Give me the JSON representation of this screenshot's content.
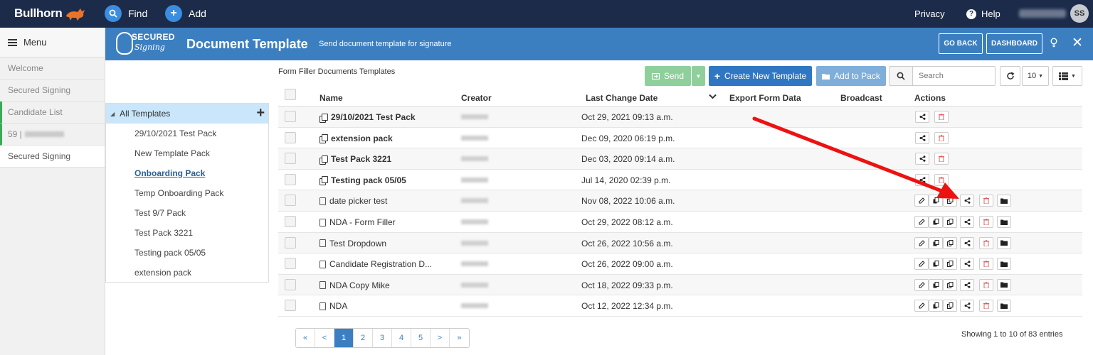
{
  "topbar": {
    "brand": "Bullhorn",
    "find_label": "Find",
    "add_label": "Add",
    "privacy_label": "Privacy",
    "help_label": "Help",
    "avatar_initials": "SS"
  },
  "menu": {
    "title": "Menu",
    "items": [
      {
        "label": "Welcome"
      },
      {
        "label": "Secured Signing"
      },
      {
        "label": "Candidate List"
      },
      {
        "label": "59 |"
      },
      {
        "label": "Secured Signing"
      }
    ]
  },
  "header": {
    "logo_top": "SECURED",
    "logo_bottom": "Signing",
    "title": "Document Template",
    "subtitle": "Send document template for signature",
    "go_back_label": "GO BACK",
    "dashboard_label": "DASHBOARD"
  },
  "tree": {
    "root_label": "All Templates",
    "items": [
      {
        "label": "29/10/2021 Test Pack"
      },
      {
        "label": "New Template Pack"
      },
      {
        "label": "Onboarding Pack"
      },
      {
        "label": "Temp Onboarding Pack"
      },
      {
        "label": "Test 9/7 Pack"
      },
      {
        "label": "Test Pack 3221"
      },
      {
        "label": "Testing pack 05/05"
      },
      {
        "label": "extension pack"
      }
    ]
  },
  "main": {
    "section_title": "Form Filler Documents Templates",
    "send_label": "Send",
    "create_label": "Create New Template",
    "add_pack_label": "Add to Pack",
    "search_placeholder": "Search",
    "page_size": "10",
    "columns": {
      "name": "Name",
      "creator": "Creator",
      "last_change": "Last Change Date",
      "export": "Export Form Data",
      "broadcast": "Broadcast",
      "actions": "Actions"
    },
    "rows": [
      {
        "name": "29/10/2021 Test Pack",
        "date": "Oct 29, 2021 09:13 a.m."
      },
      {
        "name": "extension pack",
        "date": "Dec 09, 2020 06:19 p.m."
      },
      {
        "name": "Test Pack 3221",
        "date": "Dec 03, 2020 09:14 a.m."
      },
      {
        "name": "Testing pack 05/05",
        "date": "Jul 14, 2020 02:39 p.m."
      },
      {
        "name": "date picker test",
        "date": "Nov 08, 2022 10:06 a.m."
      },
      {
        "name": "NDA - Form Filler",
        "date": "Oct 29, 2022 08:12 a.m."
      },
      {
        "name": "Test Dropdown",
        "date": "Oct 26, 2022 10:56 a.m."
      },
      {
        "name": "Candidate Registration D...",
        "date": "Oct 26, 2022 09:00 a.m."
      },
      {
        "name": "NDA Copy Mike",
        "date": "Oct 18, 2022 09:33 p.m."
      },
      {
        "name": "NDA",
        "date": "Oct 12, 2022 12:34 p.m."
      }
    ],
    "pagination": [
      "«",
      "<",
      "1",
      "2",
      "3",
      "4",
      "5",
      ">",
      "»"
    ],
    "showing": "Showing 1 to 10 of 83 entries"
  },
  "colors": {
    "topbar": "#1c2b4a",
    "header": "#3c7fc1",
    "send": "#8fcf9b",
    "create": "#2f77c2",
    "add_pack": "#7eaed9",
    "arrow": "#ee1111"
  }
}
